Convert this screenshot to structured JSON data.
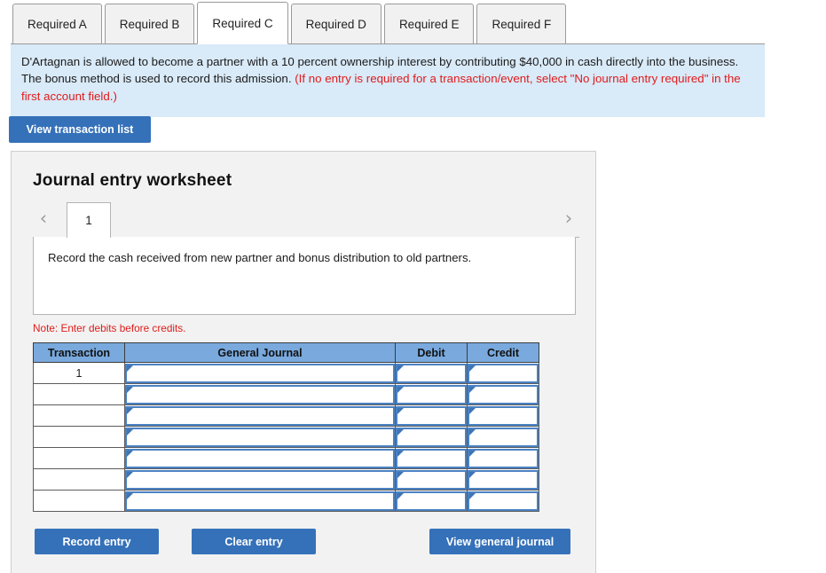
{
  "tabs": [
    {
      "label": "Required A",
      "active": false
    },
    {
      "label": "Required B",
      "active": false
    },
    {
      "label": "Required C",
      "active": true
    },
    {
      "label": "Required D",
      "active": false
    },
    {
      "label": "Required E",
      "active": false
    },
    {
      "label": "Required F",
      "active": false
    }
  ],
  "info": {
    "text_black": "D'Artagnan is allowed to become a partner with a 10 percent ownership interest by contributing $40,000 in cash directly into the business. The bonus method is used to record this admission. ",
    "text_red": "(If no entry is required for a transaction/event, select \"No journal entry required\" in the first account field.)"
  },
  "toolbar": {
    "view_transaction_list_label": "View transaction list"
  },
  "worksheet": {
    "title": "Journal entry worksheet",
    "pager": {
      "prev_icon": "‹",
      "next_icon": "›",
      "current_page": "1"
    },
    "description": "Record the cash received from new partner and bonus distribution to old partners.",
    "note": "Note: Enter debits before credits.",
    "table": {
      "headers": [
        "Transaction",
        "General Journal",
        "Debit",
        "Credit"
      ],
      "rows": [
        {
          "transaction": "1",
          "general_journal": "",
          "debit": "",
          "credit": ""
        },
        {
          "transaction": "",
          "general_journal": "",
          "debit": "",
          "credit": ""
        },
        {
          "transaction": "",
          "general_journal": "",
          "debit": "",
          "credit": ""
        },
        {
          "transaction": "",
          "general_journal": "",
          "debit": "",
          "credit": ""
        },
        {
          "transaction": "",
          "general_journal": "",
          "debit": "",
          "credit": ""
        },
        {
          "transaction": "",
          "general_journal": "",
          "debit": "",
          "credit": ""
        },
        {
          "transaction": "",
          "general_journal": "",
          "debit": "",
          "credit": ""
        }
      ]
    },
    "buttons": {
      "record_entry": "Record entry",
      "clear_entry": "Clear entry",
      "view_general_journal": "View general journal"
    }
  },
  "colors": {
    "button_blue": "#3571b9",
    "table_header_blue": "#79a9dd",
    "field_border_blue": "#4a82c3",
    "info_background": "#d9eaf8",
    "panel_background": "#f2f2f2",
    "alert_red": "#e01b1b"
  }
}
